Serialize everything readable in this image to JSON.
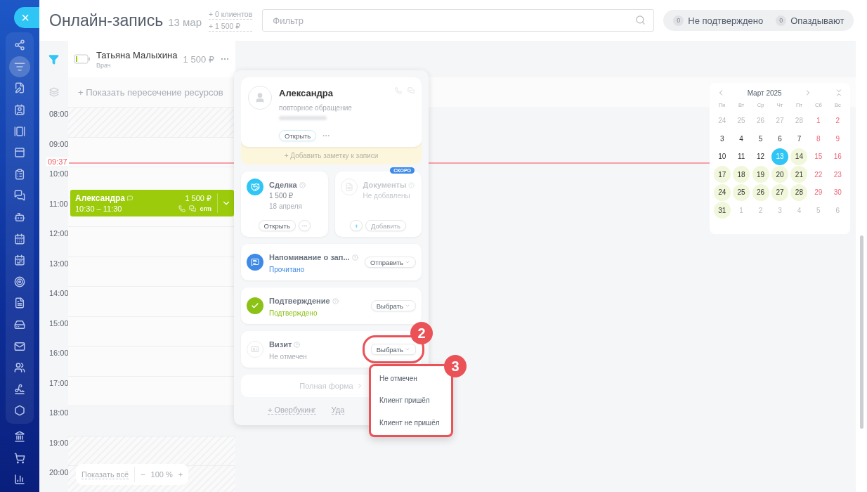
{
  "sidebar": {
    "close_button": "×",
    "apps": [
      {
        "kind": "share",
        "selected": false
      },
      {
        "kind": "filter",
        "selected": true
      },
      {
        "kind": "edit",
        "selected": false
      },
      {
        "kind": "contact",
        "selected": false
      },
      {
        "kind": "gallery",
        "selected": false
      },
      {
        "kind": "panel",
        "selected": false
      },
      {
        "kind": "tasks",
        "selected": false
      },
      {
        "kind": "chat",
        "selected": false
      },
      {
        "kind": "robot",
        "selected": false
      },
      {
        "kind": "calendar",
        "selected": false
      },
      {
        "kind": "schedule",
        "selected": false
      },
      {
        "kind": "target",
        "selected": false
      },
      {
        "kind": "document",
        "selected": false
      },
      {
        "kind": "storage",
        "selected": false
      },
      {
        "kind": "mail",
        "selected": false
      },
      {
        "kind": "users",
        "selected": false
      },
      {
        "kind": "sign",
        "selected": false
      },
      {
        "kind": "hexagon",
        "selected": false
      }
    ],
    "extra": [
      {
        "kind": "bank",
        "selected": false
      },
      {
        "kind": "cart",
        "selected": false
      },
      {
        "kind": "chart",
        "selected": false
      }
    ]
  },
  "header": {
    "title": "Онлайн-запись",
    "date": "13 мар",
    "stats": [
      "+ 0 клиентов",
      "+ 1 500 ₽"
    ],
    "filter": {
      "placeholder": "Фильтр"
    },
    "counters": [
      {
        "count": "0",
        "label": "Не подтверждено"
      },
      {
        "count": "0",
        "label": "Опаздывают"
      }
    ]
  },
  "resource": {
    "name": "Татьяна Малыхина",
    "role": "Врач",
    "amount": "1 500 ₽",
    "overlap_link": "+ Показать пересечение ресурсов"
  },
  "hours": [
    {
      "time": "08:00",
      "kind": "closed"
    },
    {
      "time": "09:00",
      "kind": "open"
    },
    {
      "time": "10:00",
      "kind": "open"
    },
    {
      "time": "11:00",
      "kind": "open"
    },
    {
      "time": "12:00",
      "kind": "open"
    },
    {
      "time": "13:00",
      "kind": "open"
    },
    {
      "time": "14:00",
      "kind": "open"
    },
    {
      "time": "15:00",
      "kind": "open"
    },
    {
      "time": "16:00",
      "kind": "open"
    },
    {
      "time": "17:00",
      "kind": "open"
    },
    {
      "time": "18:00",
      "kind": "break"
    },
    {
      "time": "19:00",
      "kind": "closed"
    },
    {
      "time": "20:00",
      "kind": "closed"
    }
  ],
  "now": "09:37",
  "event": {
    "name": "Александра",
    "time": "10:30 – 11:30",
    "price": "1 500 ₽",
    "tag": "crm"
  },
  "zoom": {
    "show_all": "Показать всё",
    "minus": "−",
    "value": "100 %",
    "plus": "+"
  },
  "popup": {
    "client": {
      "name": "Александра",
      "note": "повторное обращение",
      "open_button": "Открыть",
      "add_note": "+ Добавить заметку к записи"
    },
    "deal": {
      "title": "Сделка",
      "amount": "1 500 ₽",
      "date": "18 апреля",
      "button": "Открыть"
    },
    "documents": {
      "title": "Документы",
      "status": "Не добавлены",
      "badge": "СКОРО",
      "plus": "+",
      "button": "Добавить",
      "disabled": true
    },
    "rows": [
      {
        "kind": "sms",
        "title": "Напоминание о зап...",
        "status": "Прочитано",
        "button": "Отправить"
      },
      {
        "kind": "confirmed",
        "title": "Подтверждение",
        "status": "Подтверждено",
        "button": "Выбрать"
      },
      {
        "kind": "visit",
        "title": "Визит",
        "status": "Не отмечен",
        "button": "Выбрать",
        "highlighted": true
      }
    ],
    "full_form": "Полная форма",
    "overbooking": "+ Овербукинг",
    "delete": "Уда"
  },
  "dropdown": {
    "options": [
      "Не отмечен",
      "Клиент пришёл",
      "Клиент не пришёл"
    ]
  },
  "annotations": [
    "2",
    "3"
  ],
  "calendar": {
    "month": "Март 2025",
    "weekdays": [
      "Пн",
      "Вт",
      "Ср",
      "Чт",
      "Пт",
      "Сб",
      "Вс"
    ],
    "weeks": [
      [
        {
          "d": "24",
          "outside": true,
          "weekend": false,
          "available": false,
          "selected": false
        },
        {
          "d": "25",
          "outside": true,
          "weekend": false,
          "available": false,
          "selected": false
        },
        {
          "d": "26",
          "outside": true,
          "weekend": false,
          "available": false,
          "selected": false
        },
        {
          "d": "27",
          "outside": true,
          "weekend": false,
          "available": false,
          "selected": false
        },
        {
          "d": "28",
          "outside": true,
          "weekend": false,
          "available": false,
          "selected": false
        },
        {
          "d": "1",
          "outside": false,
          "weekend": true,
          "available": false,
          "selected": false
        },
        {
          "d": "2",
          "outside": false,
          "weekend": true,
          "available": false,
          "selected": false
        }
      ],
      [
        {
          "d": "3",
          "outside": false,
          "weekend": false,
          "available": false,
          "selected": false
        },
        {
          "d": "4",
          "outside": false,
          "weekend": false,
          "available": false,
          "selected": false
        },
        {
          "d": "5",
          "outside": false,
          "weekend": false,
          "available": false,
          "selected": false
        },
        {
          "d": "6",
          "outside": false,
          "weekend": false,
          "available": false,
          "selected": false
        },
        {
          "d": "7",
          "outside": false,
          "weekend": false,
          "available": false,
          "selected": false
        },
        {
          "d": "8",
          "outside": false,
          "weekend": true,
          "available": false,
          "selected": false
        },
        {
          "d": "9",
          "outside": false,
          "weekend": true,
          "available": false,
          "selected": false
        }
      ],
      [
        {
          "d": "10",
          "outside": false,
          "weekend": false,
          "available": false,
          "selected": false
        },
        {
          "d": "11",
          "outside": false,
          "weekend": false,
          "available": false,
          "selected": false
        },
        {
          "d": "12",
          "outside": false,
          "weekend": false,
          "available": false,
          "selected": false
        },
        {
          "d": "13",
          "outside": false,
          "weekend": false,
          "available": false,
          "selected": true
        },
        {
          "d": "14",
          "outside": false,
          "weekend": false,
          "available": true,
          "selected": false
        },
        {
          "d": "15",
          "outside": false,
          "weekend": true,
          "available": false,
          "selected": false
        },
        {
          "d": "16",
          "outside": false,
          "weekend": true,
          "available": false,
          "selected": false
        }
      ],
      [
        {
          "d": "17",
          "outside": false,
          "weekend": false,
          "available": true,
          "selected": false
        },
        {
          "d": "18",
          "outside": false,
          "weekend": false,
          "available": true,
          "selected": false
        },
        {
          "d": "19",
          "outside": false,
          "weekend": false,
          "available": true,
          "selected": false
        },
        {
          "d": "20",
          "outside": false,
          "weekend": false,
          "available": true,
          "selected": false
        },
        {
          "d": "21",
          "outside": false,
          "weekend": false,
          "available": true,
          "selected": false
        },
        {
          "d": "22",
          "outside": false,
          "weekend": true,
          "available": false,
          "selected": false
        },
        {
          "d": "23",
          "outside": false,
          "weekend": true,
          "available": false,
          "selected": false
        }
      ],
      [
        {
          "d": "24",
          "outside": false,
          "weekend": false,
          "available": true,
          "selected": false
        },
        {
          "d": "25",
          "outside": false,
          "weekend": false,
          "available": true,
          "selected": false
        },
        {
          "d": "26",
          "outside": false,
          "weekend": false,
          "available": true,
          "selected": false
        },
        {
          "d": "27",
          "outside": false,
          "weekend": false,
          "available": true,
          "selected": false
        },
        {
          "d": "28",
          "outside": false,
          "weekend": false,
          "available": true,
          "selected": false
        },
        {
          "d": "29",
          "outside": false,
          "weekend": true,
          "available": false,
          "selected": false
        },
        {
          "d": "30",
          "outside": false,
          "weekend": true,
          "available": false,
          "selected": false
        }
      ],
      [
        {
          "d": "31",
          "outside": false,
          "weekend": false,
          "available": true,
          "selected": false
        },
        {
          "d": "1",
          "outside": true,
          "weekend": false,
          "available": false,
          "selected": false
        },
        {
          "d": "2",
          "outside": true,
          "weekend": false,
          "available": false,
          "selected": false
        },
        {
          "d": "3",
          "outside": true,
          "weekend": false,
          "available": false,
          "selected": false
        },
        {
          "d": "4",
          "outside": true,
          "weekend": false,
          "available": false,
          "selected": false
        },
        {
          "d": "5",
          "outside": true,
          "weekend": true,
          "available": false,
          "selected": false
        },
        {
          "d": "6",
          "outside": true,
          "weekend": true,
          "available": false,
          "selected": false
        }
      ]
    ]
  }
}
